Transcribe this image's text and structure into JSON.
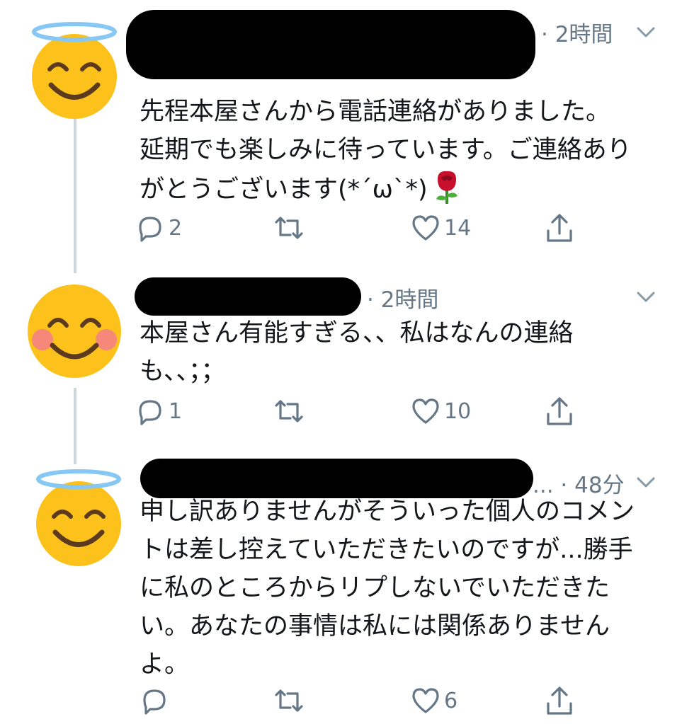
{
  "tweets": [
    {
      "time": "· 2時間",
      "lines": [
        "先程本屋さんから電話連絡がありました。",
        "延期でも楽しみに待っています。ご連絡あり",
        "がとうございます(*´ω`*)"
      ],
      "emoji": "rose-emoji",
      "avatar": "smiling-face-with-halo",
      "reply_count": "2",
      "retweet_count": "",
      "like_count": "14"
    },
    {
      "time": "· 2時間",
      "lines": [
        "本屋さん有能すぎる、、私はなんの連絡",
        "も、、；；"
      ],
      "avatar": "smiling-face-with-blush",
      "reply_count": "1",
      "retweet_count": "",
      "like_count": "10"
    },
    {
      "time": "... · 48分",
      "lines": [
        "申し訳ありませんがそういった個人のコメン",
        "トは差し控えていただきたいのですが...勝手",
        "に私のところからリプしないでいただきた",
        "い。あなたの事情は私には関係ありません",
        "よ。"
      ],
      "avatar": "smiling-face-with-halo",
      "reply_count": "",
      "retweet_count": "",
      "like_count": "6"
    }
  ],
  "colors": {
    "emoji_yellow": "#fcc21b",
    "halo_blue": "#86c7f4",
    "feature_brown": "#5c3a1e",
    "blush": "#f47e8a",
    "icon_gray": "#657786",
    "thread_line": "#ccd6dd"
  }
}
